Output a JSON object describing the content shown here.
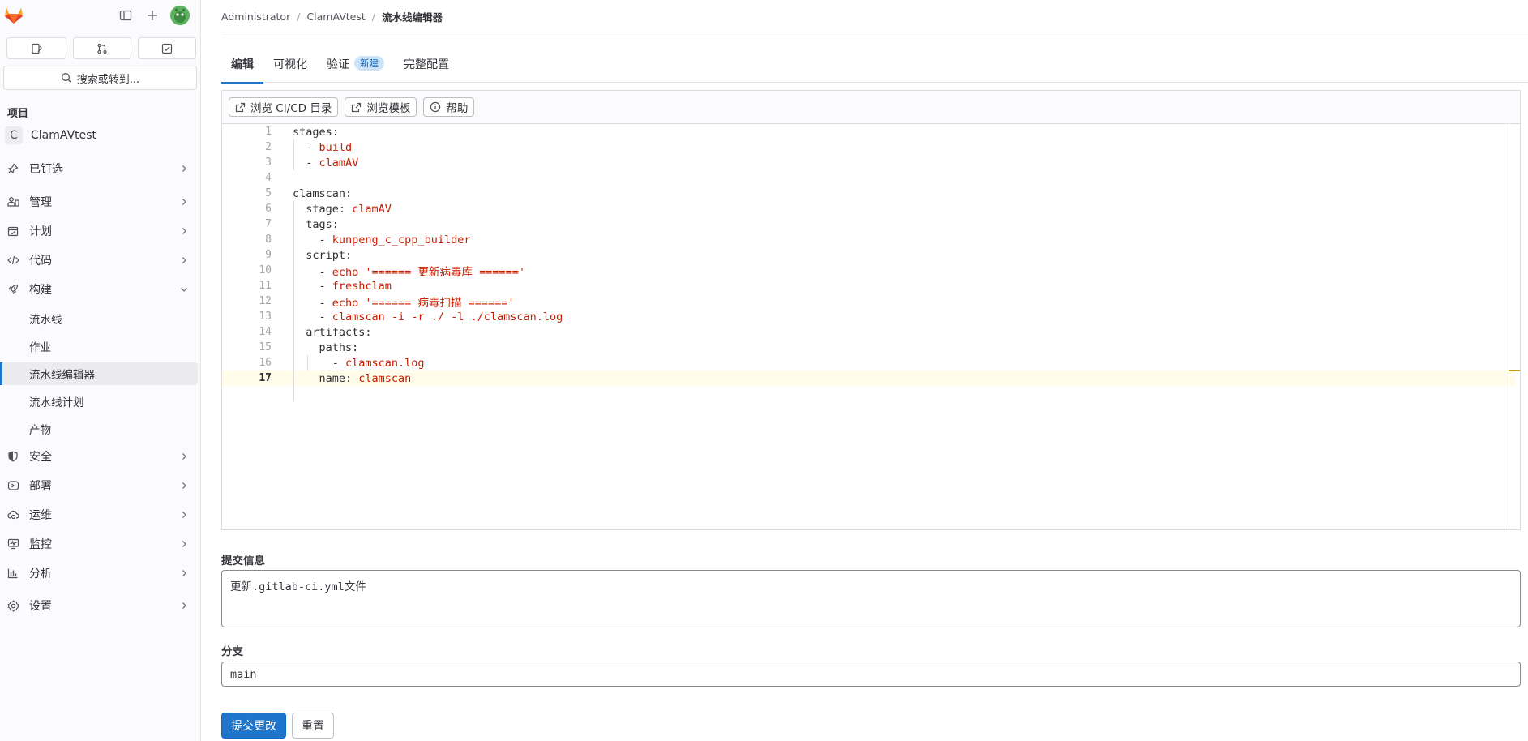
{
  "sidebar": {
    "search_label": "搜索或转到...",
    "section_title": "项目",
    "project": {
      "initial": "C",
      "name": "ClamAVtest"
    },
    "nav": [
      {
        "label": "已钉选",
        "icon": "pin-icon"
      },
      {
        "label": "管理",
        "icon": "users-icon"
      },
      {
        "label": "计划",
        "icon": "calendar-icon"
      },
      {
        "label": "代码",
        "icon": "code-icon"
      },
      {
        "label": "构建",
        "icon": "rocket-icon"
      },
      {
        "label": "安全",
        "icon": "shield-icon"
      },
      {
        "label": "部署",
        "icon": "deployments-icon"
      },
      {
        "label": "运维",
        "icon": "cloud-gear-icon"
      },
      {
        "label": "监控",
        "icon": "monitor-icon"
      },
      {
        "label": "分析",
        "icon": "chart-icon"
      },
      {
        "label": "设置",
        "icon": "settings-icon"
      }
    ],
    "build_sub": [
      "流水线",
      "作业",
      "流水线编辑器",
      "流水线计划",
      "产物"
    ]
  },
  "breadcrumb": [
    "Administrator",
    "ClamAVtest",
    "流水线编辑器"
  ],
  "tabs": [
    {
      "label": "编辑"
    },
    {
      "label": "可视化"
    },
    {
      "label": "验证",
      "badge": "新建"
    },
    {
      "label": "完整配置"
    }
  ],
  "toolbar": {
    "browse_catalog": "浏览 CI/CD 目录",
    "browse_templates": "浏览模板",
    "help": "帮助"
  },
  "code_lines": [
    {
      "n": "1",
      "k": "stages:",
      "v": ""
    },
    {
      "n": "2",
      "k": "  - ",
      "v": "build"
    },
    {
      "n": "3",
      "k": "  - ",
      "v": "clamAV"
    },
    {
      "n": "4",
      "k": "",
      "v": ""
    },
    {
      "n": "5",
      "k": "clamscan:",
      "v": ""
    },
    {
      "n": "6",
      "k": "  stage: ",
      "v": "clamAV"
    },
    {
      "n": "7",
      "k": "  tags:",
      "v": ""
    },
    {
      "n": "8",
      "k": "    - ",
      "v": "kunpeng_c_cpp_builder"
    },
    {
      "n": "9",
      "k": "  script:",
      "v": ""
    },
    {
      "n": "10",
      "k": "    - ",
      "v": "echo '====== 更新病毒库 ======'"
    },
    {
      "n": "11",
      "k": "    - ",
      "v": "freshclam"
    },
    {
      "n": "12",
      "k": "    - ",
      "v": "echo '====== 病毒扫描 ======'"
    },
    {
      "n": "13",
      "k": "    - ",
      "v": "clamscan -i -r ./ -l ./clamscan.log"
    },
    {
      "n": "14",
      "k": "  artifacts:",
      "v": ""
    },
    {
      "n": "15",
      "k": "    paths:",
      "v": ""
    },
    {
      "n": "16",
      "k": "      - ",
      "v": "clamscan.log"
    },
    {
      "n": "17",
      "k": "    name: ",
      "v": "clamscan"
    }
  ],
  "form": {
    "commit_label": "提交信息",
    "commit_value": "更新.gitlab-ci.yml文件",
    "branch_label": "分支",
    "branch_value": "main",
    "submit_label": "提交更改",
    "reset_label": "重置"
  },
  "colors": {
    "accent": "#1f75cb",
    "code_value": "#c91c00",
    "current_line": "#fffde9"
  }
}
